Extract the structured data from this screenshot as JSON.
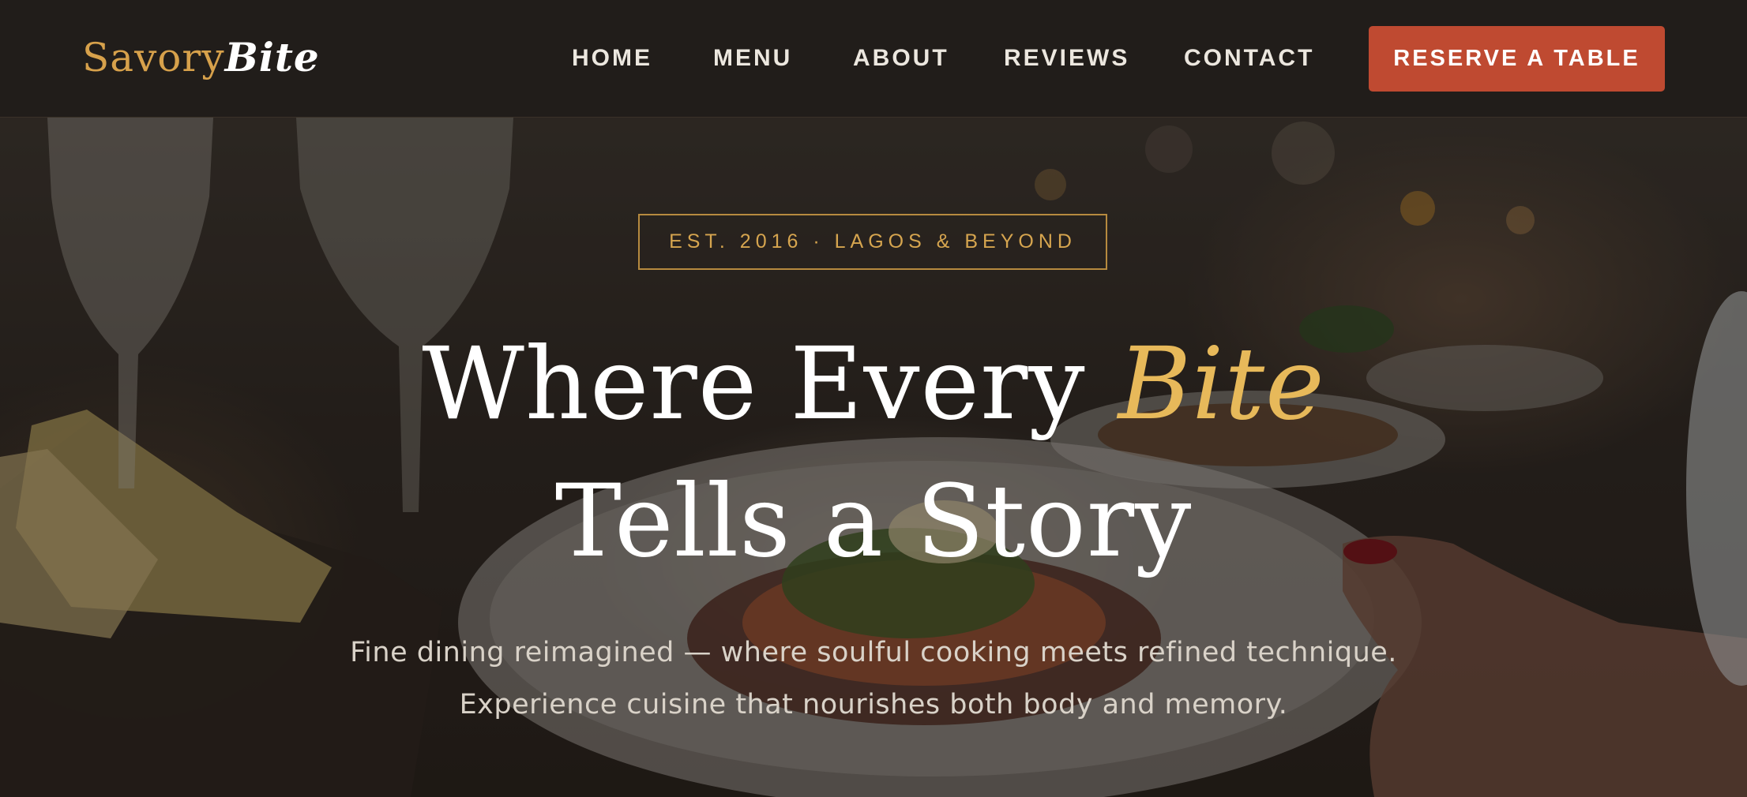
{
  "brand": {
    "name_part1": "Savory",
    "name_part2": "Bite",
    "accent_color": "#d7a14b"
  },
  "nav": {
    "items": [
      {
        "label": "HOME"
      },
      {
        "label": "MENU"
      },
      {
        "label": "ABOUT"
      },
      {
        "label": "REVIEWS"
      },
      {
        "label": "CONTACT"
      }
    ],
    "cta_label": "RESERVE A TABLE",
    "cta_color": "#bf4a31"
  },
  "hero": {
    "badge": "EST. 2016 · LAGOS & BEYOND",
    "headline_part1": "Where Every",
    "headline_accent": "Bite",
    "headline_line2": "Tells a Story",
    "sub_line1": "Fine dining reimagined — where soulful cooking meets refined technique.",
    "sub_line2": "Experience cuisine that nourishes both body and memory.",
    "accent_color": "#e7b95a",
    "background_image": "restaurant-table-photo"
  }
}
